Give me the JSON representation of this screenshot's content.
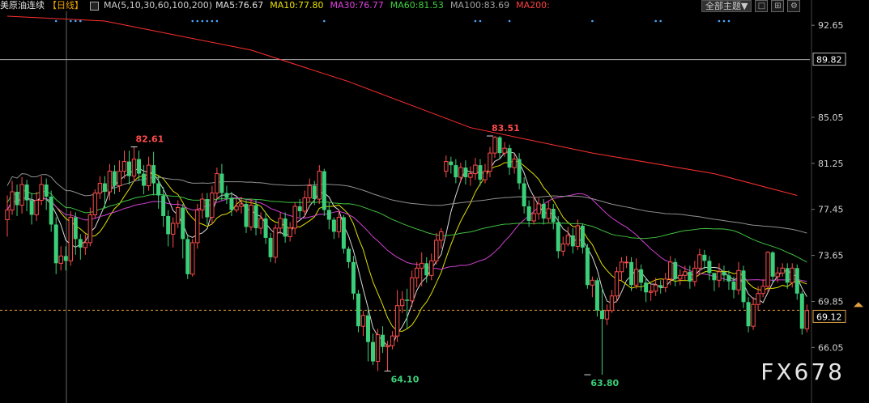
{
  "legend": {
    "title": "美原油连续",
    "timeframe": "【日线】",
    "ma_params": "MA(5,10,30,60,100,200)",
    "items": [
      {
        "label": "MA5:76.67",
        "color": "#e0e0e0"
      },
      {
        "label": "MA10:77.80",
        "color": "#e8e000"
      },
      {
        "label": "MA30:76.77",
        "color": "#e040e0"
      },
      {
        "label": "MA60:81.53",
        "color": "#40d040"
      },
      {
        "label": "MA100:83.69",
        "color": "#a0a0a0"
      },
      {
        "label": "MA200:",
        "color": "#ff4040"
      }
    ]
  },
  "toolbar": {
    "theme_select": "全部主题",
    "arrow": "▼",
    "btn1": "□",
    "btn2": "⊞",
    "btn3": "⚙"
  },
  "watermark": "FX678",
  "chart_data": {
    "type": "candlestick",
    "ylim": [
      62.2,
      93.6
    ],
    "yticks": [
      92.65,
      85.05,
      81.25,
      77.45,
      73.65,
      69.85,
      66.05
    ],
    "last_price": 69.12,
    "reference_level": 89.82,
    "annotations": [
      {
        "label": "82.61",
        "index": 26,
        "value": 82.61,
        "kind": "high"
      },
      {
        "label": "83.51",
        "index": 99,
        "value": 83.51,
        "kind": "high"
      },
      {
        "label": "64.10",
        "index": 78,
        "value": 64.1,
        "kind": "low"
      },
      {
        "label": "63.80",
        "index": 119,
        "value": 63.8,
        "kind": "low"
      }
    ],
    "candles": [
      [
        76.6,
        77.4,
        75.2,
        78.6
      ],
      [
        77.4,
        78.9,
        77.0,
        79.8
      ],
      [
        78.9,
        77.8,
        76.9,
        79.5
      ],
      [
        77.8,
        79.5,
        77.1,
        80.1
      ],
      [
        79.5,
        78.2,
        77.3,
        79.9
      ],
      [
        78.2,
        77.0,
        76.2,
        78.8
      ],
      [
        77.0,
        78.2,
        76.5,
        78.9
      ],
      [
        78.2,
        79.5,
        77.8,
        80.2
      ],
      [
        79.5,
        78.5,
        77.4,
        80.0
      ],
      [
        78.5,
        76.2,
        75.6,
        79.0
      ],
      [
        76.2,
        73.0,
        72.1,
        76.8
      ],
      [
        73.0,
        73.6,
        72.4,
        74.4
      ],
      [
        73.6,
        73.2,
        72.4,
        74.4
      ],
      [
        73.2,
        76.8,
        72.8,
        77.3
      ],
      [
        76.8,
        75.0,
        73.7,
        77.2
      ],
      [
        75.0,
        74.3,
        73.3,
        75.4
      ],
      [
        74.3,
        74.7,
        73.7,
        75.4
      ],
      [
        74.7,
        77.0,
        74.4,
        77.6
      ],
      [
        77.0,
        78.8,
        76.7,
        79.1
      ],
      [
        78.8,
        79.6,
        78.3,
        80.2
      ],
      [
        79.6,
        78.9,
        77.6,
        80.2
      ],
      [
        78.9,
        80.6,
        78.2,
        81.2
      ],
      [
        80.6,
        79.4,
        78.7,
        81.1
      ],
      [
        79.4,
        80.6,
        78.9,
        81.5
      ],
      [
        80.6,
        81.4,
        80.0,
        82.3
      ],
      [
        81.4,
        80.2,
        79.5,
        82.3
      ],
      [
        80.2,
        81.6,
        79.8,
        82.6
      ],
      [
        81.6,
        80.4,
        79.8,
        82.3
      ],
      [
        80.4,
        79.4,
        78.7,
        81.1
      ],
      [
        79.4,
        81.1,
        79.0,
        81.8
      ],
      [
        81.1,
        79.6,
        78.6,
        82.2
      ],
      [
        79.6,
        78.6,
        77.5,
        80.2
      ],
      [
        78.6,
        76.9,
        76.0,
        79.3
      ],
      [
        76.9,
        75.4,
        74.4,
        77.4
      ],
      [
        75.4,
        76.3,
        74.3,
        76.8
      ],
      [
        76.3,
        77.6,
        75.9,
        78.2
      ],
      [
        77.6,
        75.0,
        73.4,
        77.9
      ],
      [
        75.0,
        72.1,
        71.7,
        75.4
      ],
      [
        72.1,
        74.7,
        71.9,
        75.0
      ],
      [
        74.7,
        77.4,
        74.2,
        77.9
      ],
      [
        77.4,
        78.3,
        76.7,
        78.8
      ],
      [
        78.3,
        76.8,
        76.2,
        78.8
      ],
      [
        76.8,
        78.8,
        76.2,
        79.4
      ],
      [
        78.8,
        80.4,
        78.3,
        80.9
      ],
      [
        80.4,
        78.8,
        78.2,
        81.2
      ],
      [
        78.8,
        78.4,
        77.9,
        79.4
      ],
      [
        78.4,
        77.4,
        76.9,
        78.9
      ],
      [
        77.4,
        77.7,
        77.2,
        78.3
      ],
      [
        77.7,
        77.9,
        77.1,
        78.5
      ],
      [
        77.9,
        76.0,
        75.5,
        78.2
      ],
      [
        76.0,
        77.8,
        75.7,
        78.3
      ],
      [
        77.8,
        75.9,
        75.3,
        78.3
      ],
      [
        75.9,
        76.7,
        75.4,
        77.2
      ],
      [
        76.7,
        75.1,
        74.6,
        77.2
      ],
      [
        75.1,
        73.5,
        73.1,
        75.5
      ],
      [
        73.5,
        75.9,
        73.0,
        76.2
      ],
      [
        75.9,
        76.7,
        75.4,
        77.2
      ],
      [
        76.7,
        75.2,
        74.7,
        77.2
      ],
      [
        75.2,
        75.9,
        74.8,
        76.4
      ],
      [
        75.9,
        77.7,
        75.4,
        78.0
      ],
      [
        77.7,
        77.3,
        76.8,
        78.3
      ],
      [
        77.3,
        78.4,
        76.8,
        79.0
      ],
      [
        78.4,
        79.4,
        78.0,
        80.0
      ],
      [
        79.4,
        78.3,
        77.8,
        79.8
      ],
      [
        78.3,
        80.6,
        77.9,
        81.1
      ],
      [
        80.6,
        77.4,
        76.9,
        80.8
      ],
      [
        77.4,
        76.6,
        75.8,
        78.0
      ],
      [
        76.6,
        75.6,
        75.0,
        76.8
      ],
      [
        75.6,
        76.8,
        75.1,
        77.4
      ],
      [
        76.8,
        74.2,
        73.8,
        77.0
      ],
      [
        74.2,
        73.1,
        72.6,
        74.4
      ],
      [
        73.1,
        70.5,
        70.0,
        73.6
      ],
      [
        70.5,
        67.8,
        67.3,
        70.8
      ],
      [
        67.8,
        68.7,
        67.0,
        69.1
      ],
      [
        68.7,
        66.5,
        64.9,
        69.2
      ],
      [
        66.5,
        64.9,
        64.6,
        67.2
      ],
      [
        64.9,
        67.1,
        64.1,
        67.6
      ],
      [
        67.1,
        66.1,
        65.6,
        67.8
      ],
      [
        66.1,
        66.2,
        64.1,
        66.6
      ],
      [
        66.2,
        67.0,
        65.9,
        67.4
      ],
      [
        67.0,
        69.5,
        66.5,
        70.8
      ],
      [
        69.5,
        70.0,
        68.9,
        70.7
      ],
      [
        70.0,
        69.9,
        67.6,
        70.9
      ],
      [
        69.9,
        71.8,
        69.4,
        72.4
      ],
      [
        71.8,
        72.6,
        71.0,
        73.1
      ],
      [
        72.6,
        73.0,
        71.1,
        73.9
      ],
      [
        73.0,
        72.0,
        71.4,
        73.5
      ],
      [
        72.0,
        73.2,
        71.6,
        73.8
      ],
      [
        73.2,
        74.9,
        72.9,
        75.5
      ],
      [
        74.9,
        75.6,
        74.2,
        75.9
      ],
      [
        80.6,
        81.4,
        80.1,
        81.9
      ],
      [
        81.4,
        81.1,
        80.4,
        81.8
      ],
      [
        81.1,
        80.1,
        79.6,
        81.6
      ],
      [
        80.1,
        80.9,
        79.7,
        81.3
      ],
      [
        80.9,
        80.1,
        79.5,
        81.5
      ],
      [
        80.1,
        80.4,
        79.4,
        81.0
      ],
      [
        80.4,
        81.1,
        79.9,
        81.7
      ],
      [
        81.1,
        79.9,
        79.4,
        81.6
      ],
      [
        79.9,
        80.6,
        79.6,
        81.2
      ],
      [
        80.6,
        82.1,
        80.1,
        82.6
      ],
      [
        82.1,
        83.4,
        81.7,
        83.5
      ],
      [
        83.4,
        82.1,
        81.6,
        83.5
      ],
      [
        82.1,
        82.5,
        81.8,
        83.0
      ],
      [
        82.5,
        80.9,
        80.3,
        82.8
      ],
      [
        80.9,
        81.6,
        80.4,
        82.0
      ],
      [
        81.6,
        79.6,
        79.1,
        82.1
      ],
      [
        79.6,
        77.7,
        77.1,
        80.1
      ],
      [
        77.7,
        76.5,
        76.0,
        78.2
      ],
      [
        76.5,
        77.1,
        76.2,
        78.6
      ],
      [
        77.1,
        77.9,
        76.6,
        78.4
      ],
      [
        77.9,
        76.7,
        76.2,
        78.3
      ],
      [
        76.7,
        77.5,
        76.3,
        78.1
      ],
      [
        77.5,
        76.4,
        75.8,
        77.9
      ],
      [
        76.4,
        74.0,
        73.4,
        76.9
      ],
      [
        74.0,
        74.6,
        73.6,
        75.2
      ],
      [
        74.6,
        75.3,
        74.4,
        76.0
      ],
      [
        75.3,
        74.4,
        73.8,
        75.9
      ],
      [
        74.4,
        76.1,
        74.1,
        76.6
      ],
      [
        76.1,
        74.3,
        73.8,
        76.3
      ],
      [
        74.3,
        71.2,
        70.9,
        74.6
      ],
      [
        71.2,
        71.6,
        70.2,
        71.9
      ],
      [
        71.6,
        69.1,
        68.6,
        71.8
      ],
      [
        69.1,
        68.4,
        63.8,
        71.0
      ],
      [
        68.4,
        69.1,
        67.9,
        69.6
      ],
      [
        69.1,
        70.3,
        68.9,
        70.8
      ],
      [
        70.3,
        72.3,
        69.8,
        72.7
      ],
      [
        72.3,
        73.1,
        71.6,
        73.5
      ],
      [
        73.1,
        73.1,
        72.6,
        73.6
      ],
      [
        73.1,
        71.2,
        70.7,
        73.5
      ],
      [
        71.2,
        72.5,
        70.9,
        73.4
      ],
      [
        72.5,
        71.4,
        70.7,
        72.9
      ],
      [
        71.4,
        70.6,
        69.8,
        71.8
      ],
      [
        70.6,
        70.7,
        69.9,
        71.2
      ],
      [
        70.7,
        71.2,
        70.3,
        71.8
      ],
      [
        71.2,
        71.0,
        70.5,
        71.6
      ],
      [
        71.0,
        71.7,
        70.6,
        72.2
      ],
      [
        71.7,
        73.1,
        71.2,
        73.6
      ],
      [
        73.1,
        71.7,
        71.1,
        73.4
      ],
      [
        71.7,
        72.0,
        71.2,
        72.5
      ],
      [
        72.0,
        72.3,
        71.6,
        72.8
      ],
      [
        72.3,
        71.5,
        70.9,
        72.8
      ],
      [
        71.5,
        72.6,
        71.1,
        73.2
      ],
      [
        72.6,
        73.7,
        72.1,
        74.2
      ],
      [
        73.7,
        73.2,
        72.5,
        74.1
      ],
      [
        73.2,
        72.2,
        71.6,
        73.6
      ],
      [
        72.2,
        71.6,
        70.7,
        72.2
      ],
      [
        71.6,
        72.3,
        71.0,
        73.0
      ],
      [
        72.3,
        72.0,
        71.5,
        72.8
      ],
      [
        72.0,
        71.5,
        70.8,
        72.4
      ],
      [
        71.5,
        70.8,
        70.1,
        71.9
      ],
      [
        70.8,
        72.4,
        70.4,
        73.1
      ],
      [
        72.4,
        69.8,
        69.3,
        72.8
      ],
      [
        69.8,
        67.8,
        67.3,
        70.2
      ],
      [
        67.8,
        69.6,
        67.5,
        70.2
      ],
      [
        69.6,
        70.5,
        69.1,
        71.1
      ],
      [
        70.5,
        71.1,
        70.2,
        71.7
      ],
      [
        71.1,
        73.9,
        70.6,
        74.0
      ],
      [
        73.9,
        71.9,
        71.4,
        74.0
      ],
      [
        71.9,
        72.2,
        71.4,
        72.7
      ],
      [
        72.2,
        72.6,
        71.9,
        73.0
      ],
      [
        72.6,
        71.4,
        70.9,
        73.0
      ],
      [
        71.4,
        72.6,
        71.0,
        73.0
      ],
      [
        72.6,
        70.5,
        70.0,
        72.9
      ],
      [
        70.5,
        67.6,
        67.1,
        70.7
      ],
      [
        67.6,
        69.1,
        67.3,
        69.6
      ]
    ],
    "ma_series": [
      {
        "name": "MA5",
        "color": "#d8d8d8"
      },
      {
        "name": "MA10",
        "color": "#e0e000"
      },
      {
        "name": "MA30",
        "color": "#d040d0"
      },
      {
        "name": "MA60",
        "color": "#40c040"
      },
      {
        "name": "MA100",
        "color": "#909090"
      },
      {
        "name": "MA200",
        "color": "#ff3030",
        "points": [
          [
            0,
            93.4
          ],
          [
            20,
            93.0
          ],
          [
            50,
            90.6
          ],
          [
            70,
            88.0
          ],
          [
            95,
            84.2
          ],
          [
            120,
            82.1
          ],
          [
            145,
            80.4
          ],
          [
            162,
            78.6
          ]
        ]
      }
    ],
    "dot_marks": [
      [
        10,
        13,
        14,
        15
      ],
      [
        38,
        39,
        40,
        41,
        42,
        43
      ],
      [
        65
      ],
      [
        96,
        97
      ],
      [
        103
      ],
      [
        120
      ],
      [
        133,
        134
      ],
      [
        146,
        147,
        148
      ]
    ]
  }
}
